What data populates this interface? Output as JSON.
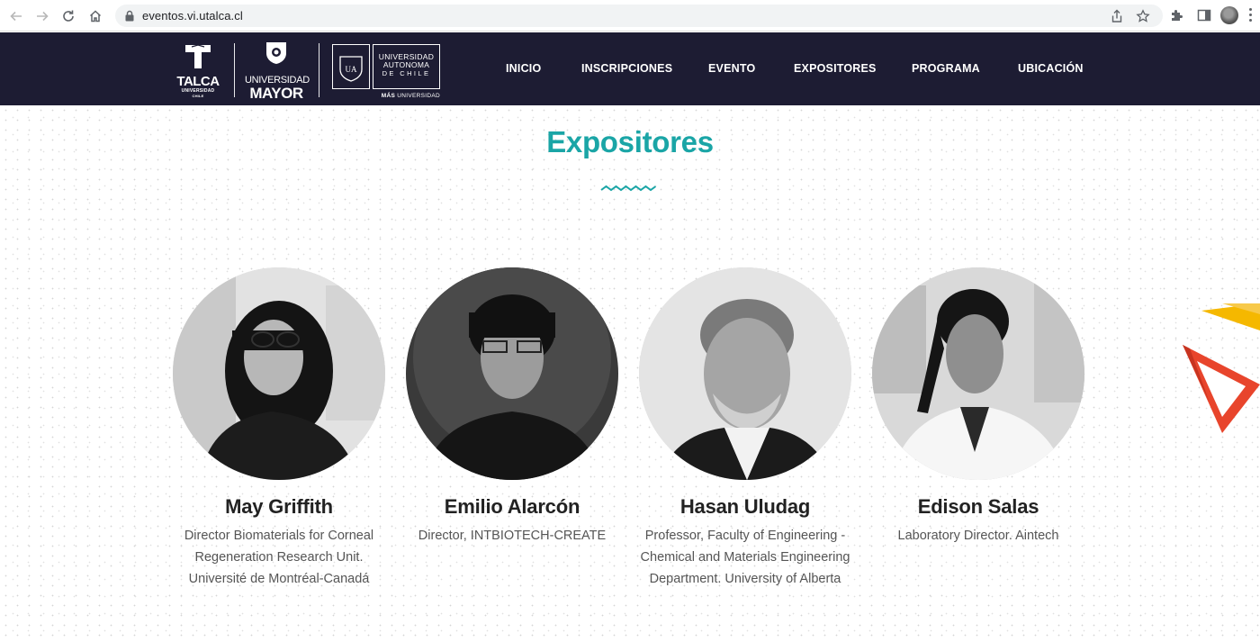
{
  "browser": {
    "url": "eventos.vi.utalca.cl",
    "icons": [
      "back-icon",
      "forward-icon",
      "reload-icon",
      "home-icon",
      "lock-icon",
      "share-icon",
      "star-icon",
      "extensions-icon",
      "sidebar-icon",
      "profile-avatar",
      "menu-icon"
    ]
  },
  "header": {
    "logos": {
      "talca": {
        "word": "TALCA",
        "sub1": "UNIVERSIDAD",
        "sub2": "CHILE"
      },
      "mayor": {
        "top": "UNIVERSIDAD",
        "bottom": "MAYOR"
      },
      "autonoma": {
        "emblem": "UA",
        "line1": "UNIVERSIDAD",
        "line2": "AUTONOMA",
        "line3": "DE CHILE",
        "tag_bold": "MÁS",
        "tag_rest": " UNIVERSIDAD"
      }
    },
    "nav": [
      {
        "label": "INICIO"
      },
      {
        "label": "INSCRIPCIONES"
      },
      {
        "label": "EVENTO"
      },
      {
        "label": "EXPOSITORES"
      },
      {
        "label": "PROGRAMA"
      },
      {
        "label": "UBICACIÓN"
      }
    ]
  },
  "section": {
    "title": "Expositores",
    "accent_color": "#1aa5a6"
  },
  "speakers": [
    {
      "name": "May Griffith",
      "role": "Director Biomaterials for Corneal Regeneration Research Unit. Université de Montréal-Canadá"
    },
    {
      "name": "Emilio Alarcón",
      "role": "Director, INTBIOTECH-CREATE"
    },
    {
      "name": "Hasan Uludag",
      "role": "Professor, Faculty of Engineering - Chemical and Materials Engineering Department. University of Alberta"
    },
    {
      "name": "Edison Salas",
      "role": "Laboratory Director. Aintech"
    }
  ],
  "colors": {
    "header_bg": "#1d1c33",
    "deco_yellow": "#f5b800",
    "deco_red": "#e8452c"
  }
}
